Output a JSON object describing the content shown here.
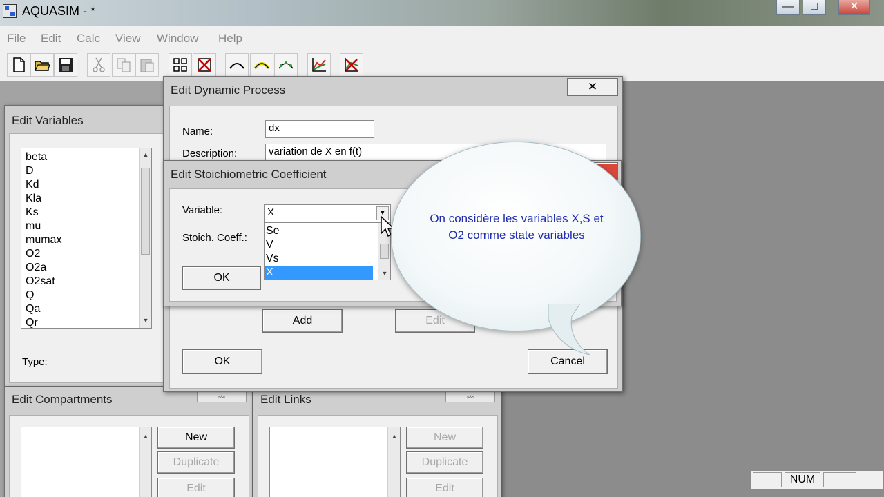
{
  "app": {
    "title": "AQUASIM -  *"
  },
  "window_controls": {
    "minimize": "—",
    "maximize": "□",
    "close": "✕"
  },
  "menu": [
    "File",
    "Edit",
    "Calc",
    "View",
    "Window",
    "Help"
  ],
  "toolbar": {
    "icons": [
      "new-file-icon",
      "open-folder-icon",
      "save-icon",
      "cut-icon",
      "copy-icon",
      "paste-icon",
      "grid-icon",
      "delete-grid-icon",
      "curve-icon",
      "curve-highlight-icon",
      "curve-points-icon",
      "plot-icon",
      "delete-plot-icon"
    ]
  },
  "edit_variables": {
    "title": "Edit Variables",
    "items": [
      "beta",
      "D",
      "Kd",
      "Kla",
      "Ks",
      "mu",
      "mumax",
      "O2",
      "O2a",
      "O2sat",
      "Q",
      "Qa",
      "Qr"
    ],
    "type_label": "Type:"
  },
  "edit_compartments": {
    "title": "Edit Compartments",
    "buttons": [
      "New",
      "Duplicate",
      "Edit"
    ]
  },
  "edit_links": {
    "title": "Edit Links",
    "buttons": [
      "New",
      "Duplicate",
      "Edit"
    ]
  },
  "dynamic_process": {
    "title": "Edit Dynamic Process",
    "name_label": "Name:",
    "name_value": "dx",
    "description_label": "Description:",
    "description_value": "variation de X en f(t)",
    "add_label": "Add",
    "edit_label": "Edit",
    "ok_label": "OK",
    "cancel_label": "Cancel"
  },
  "stoich": {
    "title": "Edit Stoichiometric Coefficient",
    "variable_label": "Variable:",
    "selected": "X",
    "coeff_label": "Stoich. Coeff.:",
    "options": [
      "Se",
      "V",
      "Vs",
      "X"
    ],
    "ok_label": "OK"
  },
  "bubble": {
    "text": "On considère les variables X,S et O2 comme state variables"
  },
  "status": {
    "num": "NUM"
  }
}
